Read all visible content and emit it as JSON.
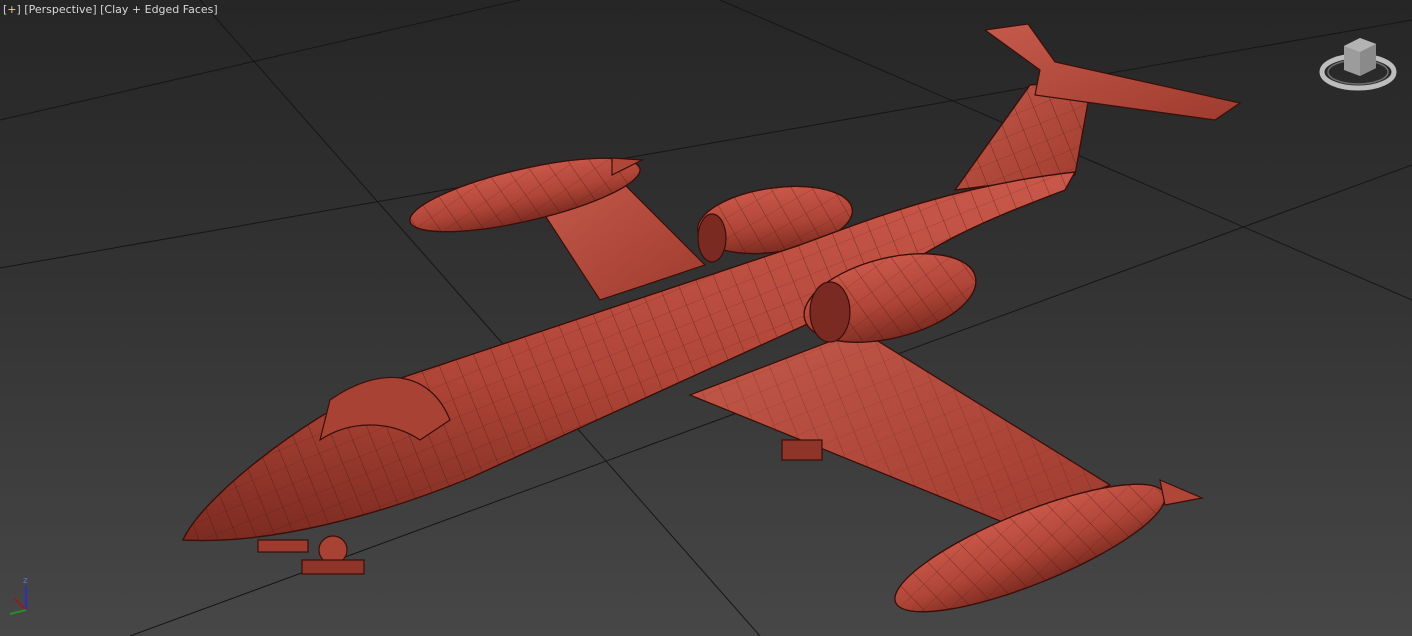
{
  "viewport": {
    "menu_label": "+",
    "view_label": "Perspective",
    "shading_label": "Clay + Edged Faces"
  },
  "axis_gizmo": {
    "z_label": "z"
  },
  "icons": [
    "viewcube-icon",
    "axis-tripod-icon"
  ],
  "colors": {
    "clay": "#b44a3c",
    "clay_dark": "#7a2a20",
    "edge": "#3a0f0a",
    "grid": "#161616",
    "label_plus": "#e8d27a"
  }
}
